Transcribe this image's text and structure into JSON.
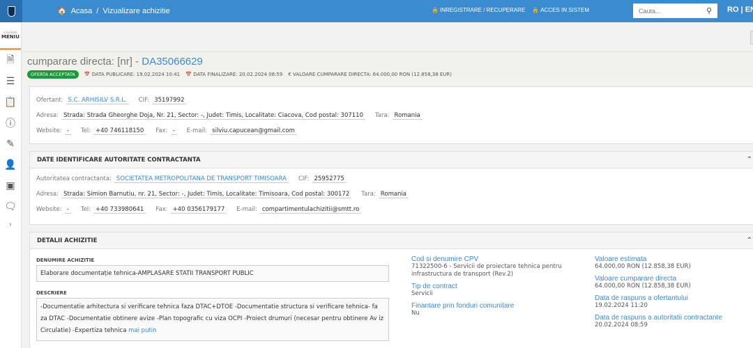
{
  "header": {
    "breadcrumb_home": "Acasa",
    "breadcrumb_sep": "/",
    "breadcrumb_current": "Vizualizare achizitie",
    "register_label": "INREGISTRARE / RECUPERARE",
    "login_label": "ACCES IN SISTEM",
    "search_placeholder": "Cauta...",
    "lang_label": "RO | EN"
  },
  "sidebar": {
    "menu_small": "e-Licitatie",
    "menu_label": "MENIU",
    "icons": [
      "document-icon",
      "list-edit-icon",
      "clipboard-icon",
      "help-icon",
      "pen-icon",
      "id-card-icon",
      "monitor-icon",
      "chat-icon"
    ],
    "expand_label": "›"
  },
  "title": {
    "prefix": "cumparare directa: [nr] - ",
    "code": "DA35066629"
  },
  "meta": {
    "status_badge": "OFERTA ACCEPTATA",
    "publish": "DATA PUBLICARE: 19.02.2024 10:41",
    "finalize": "DATA FINALIZARE: 20.02.2024 08:59",
    "value": "VALOARE CUMPARARE DIRECTA: 64.000,00  RON (12.858,38  EUR)"
  },
  "ofertant": {
    "label_ofertant": "Ofertant:",
    "name": "S.C. ARHISILV S.R.L.",
    "label_cif": "CIF:",
    "cif": "35197992",
    "label_adresa": "Adresa:",
    "adresa": "Strada: Strada Gheorghe Doja, Nr. 21, Sector: -, Judet: Timis, Localitate: Ciacova, Cod postal: 307110",
    "label_tara": "Tara:",
    "tara": "Romania",
    "label_website": "Website:",
    "website": "-",
    "label_tel": "Tel:",
    "tel": "+40 746118150",
    "label_fax": "Fax:",
    "fax": "-",
    "label_email": "E-mail:",
    "email": "silviu.capucean@gmail.com"
  },
  "autoritate": {
    "heading": "DATE IDENTIFICARE AUTORITATE CONTRACTANTA",
    "label_aut": "Autoritatea contractanta:",
    "name": "SOCIETATEA METROPOLITANA DE TRANSPORT TIMISOARA",
    "label_cif": "CIF:",
    "cif": "25952775",
    "label_adresa": "Adresa:",
    "adresa": "Strada: Simion Barnutiu, nr. 21, Sector: -, Judet: Timis, Localitate: Timisoara, Cod postal: 300172",
    "label_tara": "Tara:",
    "tara": "Romania",
    "label_website": "Website:",
    "website": "-",
    "label_tel": "Tel:",
    "tel": "+40 733980641",
    "label_fax": "Fax:",
    "fax": "+40 0356179177",
    "label_email": "E-mail:",
    "email": "compartimentulachizitii@smtt.ro"
  },
  "detalii": {
    "heading": "DETALII ACHIZITIE",
    "label_denumire": "DENUMIRE ACHIZITIE",
    "denumire": "Elaborare documentație tehnica-AMPLASARE STATII TRANSPORT PUBLIC",
    "label_descriere": "DESCRIERE",
    "descriere": "-Documentatie arhitectura si verificare tehnica faza DTAC+DTOE -Documentatie structura si verificare tehnica- fa za DTAC -Documentatie obtinere avize -Plan topografic cu viza OCPI -Proiect drumuri (necesar pentru obtinere Av iz Circulatie) -Expertiza tehnica",
    "more_link": "mai putin",
    "cpv_label": "Cod si denumire CPV",
    "cpv_value": "71322500-6 - Servicii de proiectare tehnica pentru infrastructura de transport (Rev.2)",
    "tip_label": "Tip de contract",
    "tip_value": "Servicii",
    "fin_label": "Finantare prin fonduri comunitare",
    "fin_value": "Nu",
    "val_est_label": "Valoare estimata",
    "val_est_value": "64.000,00  RON (12.858,38  EUR)",
    "val_cd_label": "Valoare cumparare directa",
    "val_cd_value": "64.000,00  RON (12.858,38  EUR)",
    "rasp_of_label": "Data de raspuns a ofertantului",
    "rasp_of_value": "19.02.2024 11:20",
    "rasp_aut_label": "Data de raspuns a autoritatii contractante",
    "rasp_aut_value": "20.02.2024 08:59"
  }
}
